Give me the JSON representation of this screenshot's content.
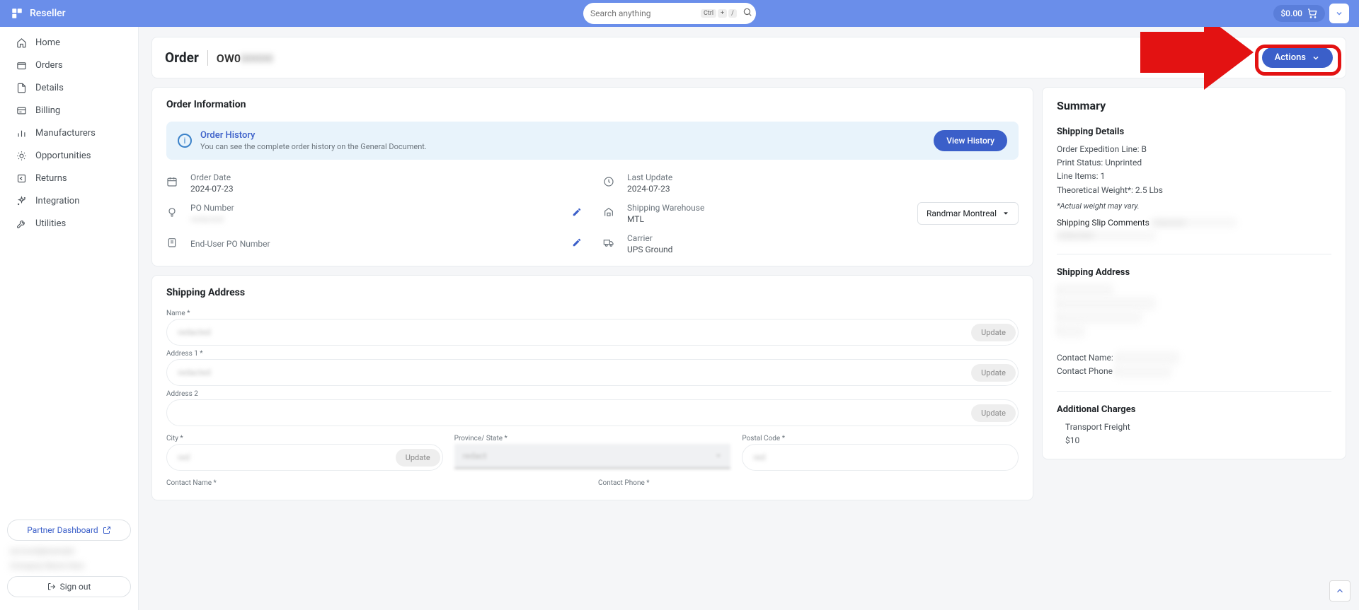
{
  "header": {
    "brand": "Reseller",
    "search_placeholder": "Search anything",
    "kbd1": "Ctrl",
    "kbd2": "+",
    "kbd3": "/",
    "cart_amount": "$0.00"
  },
  "sidebar": {
    "items": [
      {
        "label": "Home",
        "icon": "home-icon"
      },
      {
        "label": "Orders",
        "icon": "box-icon"
      },
      {
        "label": "Details",
        "icon": "document-icon"
      },
      {
        "label": "Billing",
        "icon": "billing-icon"
      },
      {
        "label": "Manufacturers",
        "icon": "chart-icon"
      },
      {
        "label": "Opportunities",
        "icon": "handshake-icon"
      },
      {
        "label": "Returns",
        "icon": "return-icon"
      },
      {
        "label": "Integration",
        "icon": "sparkle-icon"
      },
      {
        "label": "Utilities",
        "icon": "wrench-icon"
      }
    ],
    "partner_dashboard": "Partner Dashboard",
    "signout": "Sign out"
  },
  "page": {
    "title": "Order",
    "order_prefix": "OW0",
    "order_blur": "00000",
    "actions": "Actions"
  },
  "order_info": {
    "title": "Order Information",
    "history_title": "Order History",
    "history_desc": "You can see the complete order history on the General Document.",
    "view_history": "View History",
    "order_date_label": "Order Date",
    "order_date": "2024-07-23",
    "po_label": "PO Number",
    "enduser_po_label": "End-User PO Number",
    "last_update_label": "Last Update",
    "last_update": "2024-07-23",
    "warehouse_label": "Shipping Warehouse",
    "warehouse": "MTL",
    "warehouse_select": "Randmar Montreal",
    "carrier_label": "Carrier",
    "carrier": "UPS Ground"
  },
  "ship_form": {
    "title": "Shipping Address",
    "name_label": "Name *",
    "addr1_label": "Address 1 *",
    "addr2_label": "Address 2",
    "city_label": "City *",
    "state_label": "Province/ State *",
    "postal_label": "Postal Code *",
    "contact_name_label": "Contact Name *",
    "contact_phone_label": "Contact Phone *",
    "update": "Update"
  },
  "summary": {
    "title": "Summary",
    "ship_details_title": "Shipping Details",
    "exp_line": "Order Expedition Line: B",
    "print_status": "Print Status: Unprinted",
    "line_items": "Line Items: 1",
    "weight": "Theoretical Weight*: 2.5 Lbs",
    "weight_note": "*Actual weight may vary.",
    "slip_comments": "Shipping Slip Comments",
    "ship_addr_title": "Shipping Address",
    "contact_name": "Contact Name:",
    "contact_phone": "Contact Phone",
    "addl_charges_title": "Additional Charges",
    "freight_label": "Transport Freight",
    "freight_val": "$10"
  }
}
